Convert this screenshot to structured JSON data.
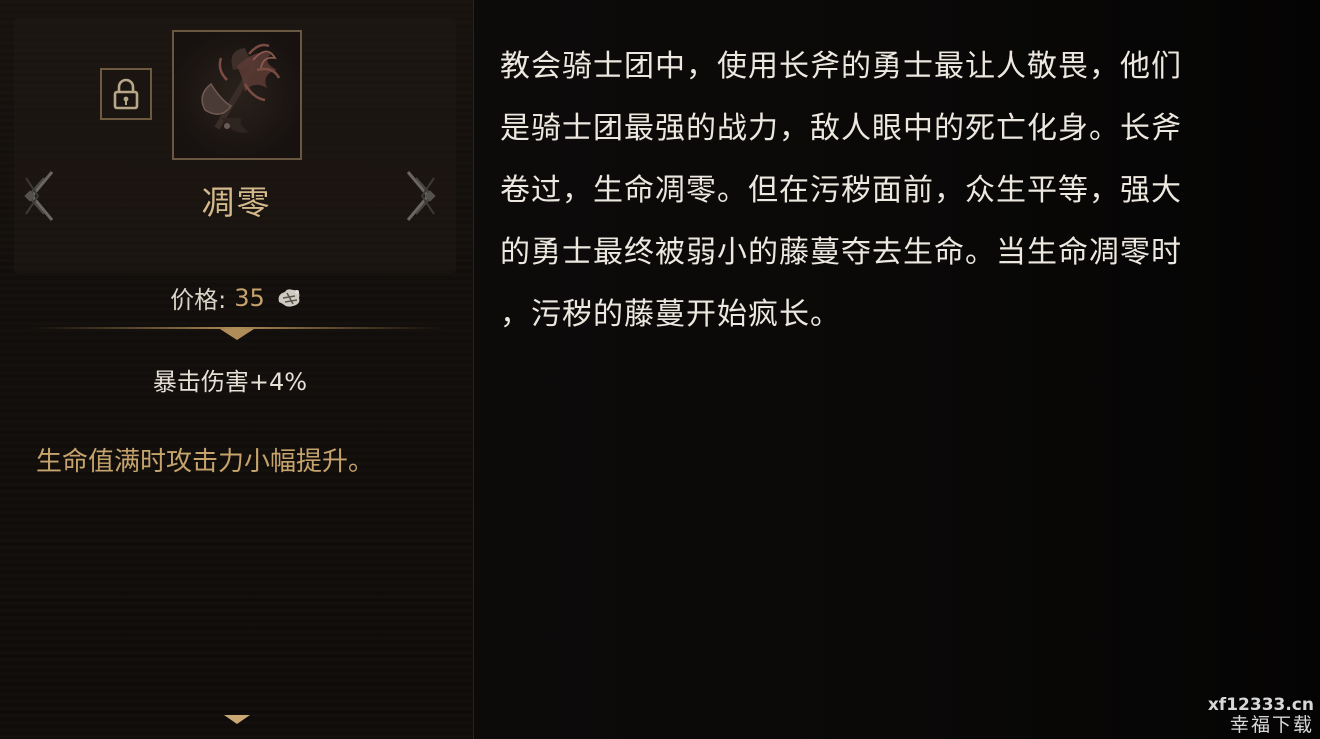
{
  "item": {
    "name": "凋零",
    "price_label": "价格:",
    "price_value": "35",
    "stat": "暴击伤害+4%",
    "effect": "生命值满时攻击力小幅提升。",
    "icon": "withered-axe-icon",
    "lock_icon": "padlock-icon",
    "currency_icon": "soul-currency-icon"
  },
  "lore": {
    "lines": [
      "教会骑士团中，使用长斧的勇士最让人敬畏，他们",
      "是骑士团最强的战力，敌人眼中的死亡化身。长斧",
      "卷过，生命凋零。但在污秽面前，众生平等，强大",
      "的勇士最终被弱小的藤蔓夺去生命。当生命凋零时",
      "，污秽的藤蔓开始疯长。"
    ]
  },
  "watermark": {
    "line1": "xf12333.cn",
    "line2": "幸福下载"
  },
  "colors": {
    "gold": "#c6a36c",
    "name_gold": "#d4b98c",
    "text": "#ece7df",
    "frame": "#6a5741"
  }
}
